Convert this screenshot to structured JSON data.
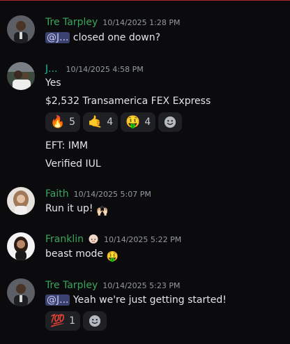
{
  "colors": {
    "background": "#0b0b0d",
    "accent_line": "#b3262d",
    "author_green": "#3ba55d",
    "author_cyan": "#1abc9c",
    "mention_bg": "#3c4270",
    "reaction_bg": "#1f2024"
  },
  "messages": [
    {
      "author": "Tre Tarpley",
      "author_color": "#3ba55d",
      "timestamp": "10/14/2025 1:28 PM",
      "mention": "@J...",
      "text": " closed one down?"
    },
    {
      "author": "J...",
      "author_color": "#1abc9c",
      "timestamp": "10/14/2025 4:58 PM",
      "lines": [
        "Yes",
        "$2,532 Transamerica FEX Express",
        "EFT: IMM",
        "Verified IUL"
      ],
      "reactions": [
        {
          "emoji": "🔥",
          "count": "5",
          "icon": "fire-icon"
        },
        {
          "emoji": "🤙",
          "count": "4",
          "icon": "call-me-hand-icon"
        },
        {
          "emoji": "🤑",
          "count": "4",
          "icon": "money-mouth-face-icon"
        }
      ]
    },
    {
      "author": "Faith",
      "author_color": "#3ba55d",
      "timestamp": "10/14/2025 5:07 PM",
      "text": "Run it up!",
      "emoji": "🙌🏻"
    },
    {
      "author": "Franklin",
      "author_color": "#3ba55d",
      "badge": "baby-face-icon",
      "timestamp": "10/14/2025 5:22 PM",
      "text": "beast mode",
      "emoji": "🤑"
    },
    {
      "author": "Tre Tarpley",
      "author_color": "#3ba55d",
      "timestamp": "10/14/2025 5:23 PM",
      "mention": "@J...",
      "text": " Yeah we're just getting started!",
      "reactions": [
        {
          "emoji": "💯",
          "count": "1",
          "icon": "hundred-points-icon"
        }
      ]
    }
  ]
}
